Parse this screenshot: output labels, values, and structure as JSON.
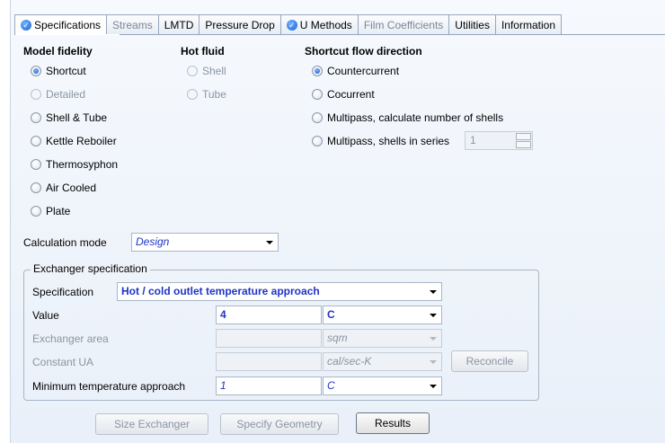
{
  "tabs": [
    {
      "label": "Specifications",
      "state": "active",
      "icon": "check-icon"
    },
    {
      "label": "Streams",
      "state": "disabled"
    },
    {
      "label": "LMTD",
      "state": "normal"
    },
    {
      "label": "Pressure Drop",
      "state": "normal"
    },
    {
      "label": "U Methods",
      "state": "normal",
      "icon": "check-icon"
    },
    {
      "label": "Film Coefficients",
      "state": "disabled"
    },
    {
      "label": "Utilities",
      "state": "normal"
    },
    {
      "label": "Information",
      "state": "normal"
    }
  ],
  "model_fidelity": {
    "header": "Model fidelity",
    "options": [
      "Shortcut",
      "Detailed",
      "Shell & Tube",
      "Kettle Reboiler",
      "Thermosyphon",
      "Air Cooled",
      "Plate"
    ],
    "selected": "Shortcut"
  },
  "hot_fluid": {
    "header": "Hot fluid",
    "options": [
      "Shell",
      "Tube"
    ]
  },
  "flow_direction": {
    "header": "Shortcut flow direction",
    "options": [
      "Countercurrent",
      "Cocurrent",
      "Multipass, calculate number of shells",
      "Multipass, shells in series"
    ],
    "selected": "Countercurrent",
    "shells_value": "1"
  },
  "calculation_mode": {
    "label": "Calculation mode",
    "value": "Design"
  },
  "exchanger_spec": {
    "group_title": "Exchanger specification",
    "specification_label": "Specification",
    "specification_value": "Hot / cold outlet temperature approach",
    "value_label": "Value",
    "value": "4",
    "value_unit": "C",
    "area_label": "Exchanger area",
    "area_value": "",
    "area_unit": "sqm",
    "ua_label": "Constant UA",
    "ua_value": "",
    "ua_unit": "cal/sec-K",
    "reconcile_label": "Reconcile",
    "min_approach_label": "Minimum temperature approach",
    "min_approach_value": "1",
    "min_approach_unit": "C"
  },
  "buttons": {
    "size_exchanger": "Size Exchanger",
    "specify_geometry": "Specify Geometry",
    "results": "Results"
  }
}
